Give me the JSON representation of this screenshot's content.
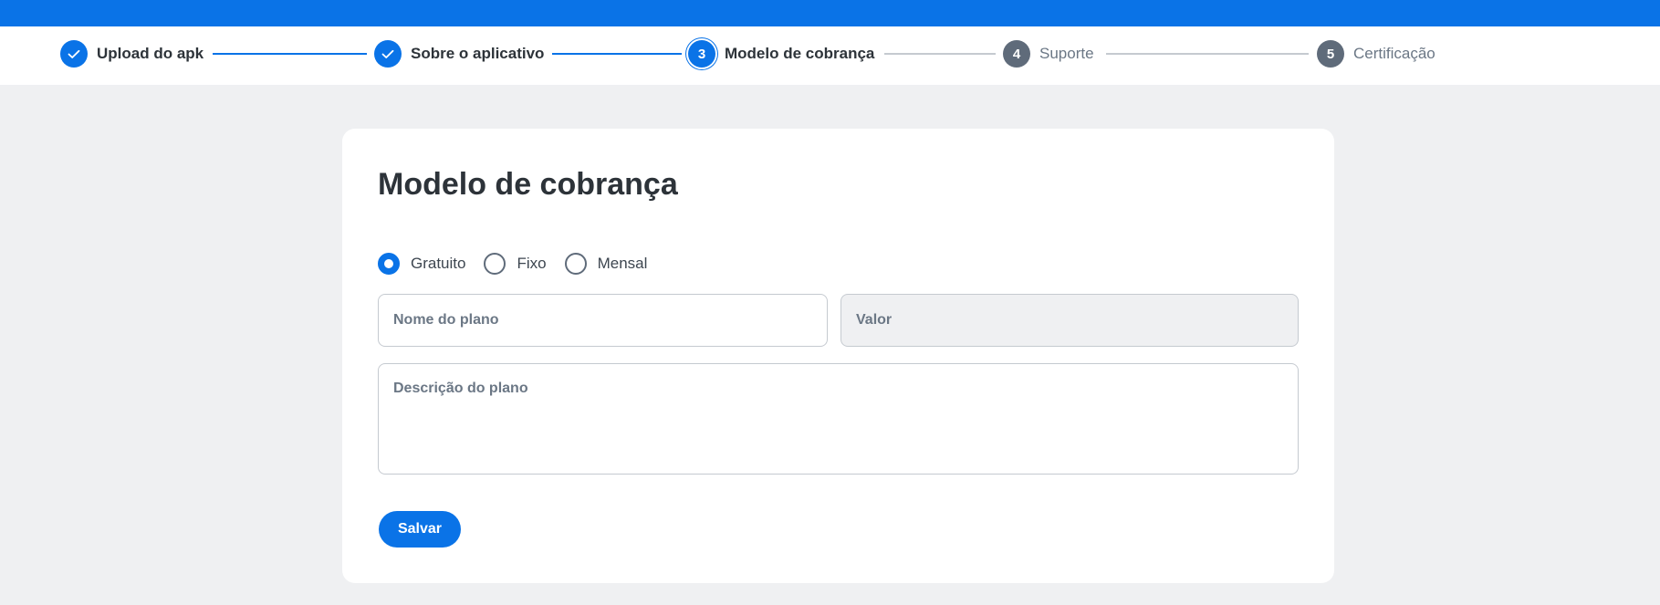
{
  "stepper": {
    "steps": [
      {
        "number": "1",
        "label": "Upload do apk",
        "status": "done",
        "icon": "check-icon"
      },
      {
        "number": "2",
        "label": "Sobre o aplicativo",
        "status": "done",
        "icon": "check-icon"
      },
      {
        "number": "3",
        "label": "Modelo de cobrança",
        "status": "current"
      },
      {
        "number": "4",
        "label": "Suporte",
        "status": "pending"
      },
      {
        "number": "5",
        "label": "Certificação",
        "status": "pending"
      }
    ],
    "colors": {
      "accent": "#0a73e7",
      "pending": "#5f6b7a",
      "line_pending": "#c5cad0"
    }
  },
  "card": {
    "title": "Modelo de cobrança",
    "pricing_options": [
      {
        "label": "Gratuito",
        "checked": true
      },
      {
        "label": "Fixo",
        "checked": false
      },
      {
        "label": "Mensal",
        "checked": false
      }
    ],
    "plan_name": {
      "placeholder": "Nome do plano",
      "value": ""
    },
    "price": {
      "placeholder": "Valor",
      "value": "",
      "disabled": true
    },
    "description": {
      "placeholder": "Descrição do plano",
      "value": ""
    },
    "save_label": "Salvar"
  }
}
